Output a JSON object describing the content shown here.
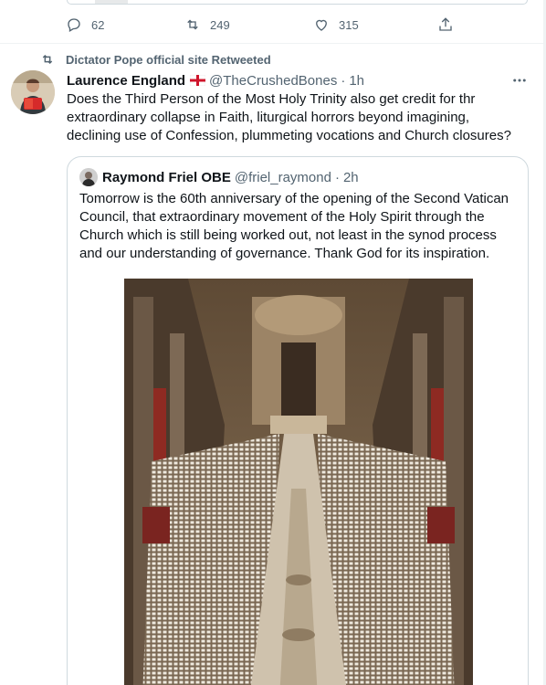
{
  "previous_tweet": {
    "actions": {
      "reply": {
        "icon": "reply-icon",
        "count": "62"
      },
      "retweet": {
        "icon": "retweet-icon",
        "count": "249"
      },
      "like": {
        "icon": "heart-icon",
        "count": "315"
      },
      "share": {
        "icon": "share-icon"
      }
    }
  },
  "tweet": {
    "retweeted_by": "Dictator Pope official site Retweeted",
    "author": {
      "name": "Laurence England",
      "flag": "england-flag-icon",
      "handle": "@TheCrushedBones",
      "separator": "·",
      "time": "1h"
    },
    "more_icon": "more-icon",
    "text": "Does the Third Person of the Most Holy Trinity also get credit for thr extraordinary collapse in Faith, liturgical horrors beyond imagining, declining use of Confession, plummeting vocations and Church closures?",
    "quote": {
      "author": {
        "name": "Raymond Friel OBE",
        "handle": "@friel_raymond",
        "separator": "·",
        "time": "2h"
      },
      "text": "Tomorrow is the 60th anniversary of the opening of the Second Vatican Council, that extraordinary movement of the Holy Spirit through the Church which is still being worked out, not least in the synod process and our understanding of governance. Thank God for its inspiration."
    }
  },
  "colors": {
    "text": "#0f1419",
    "secondary": "#536471",
    "border": "#cfd9de",
    "flag_red": "#cf142b"
  }
}
